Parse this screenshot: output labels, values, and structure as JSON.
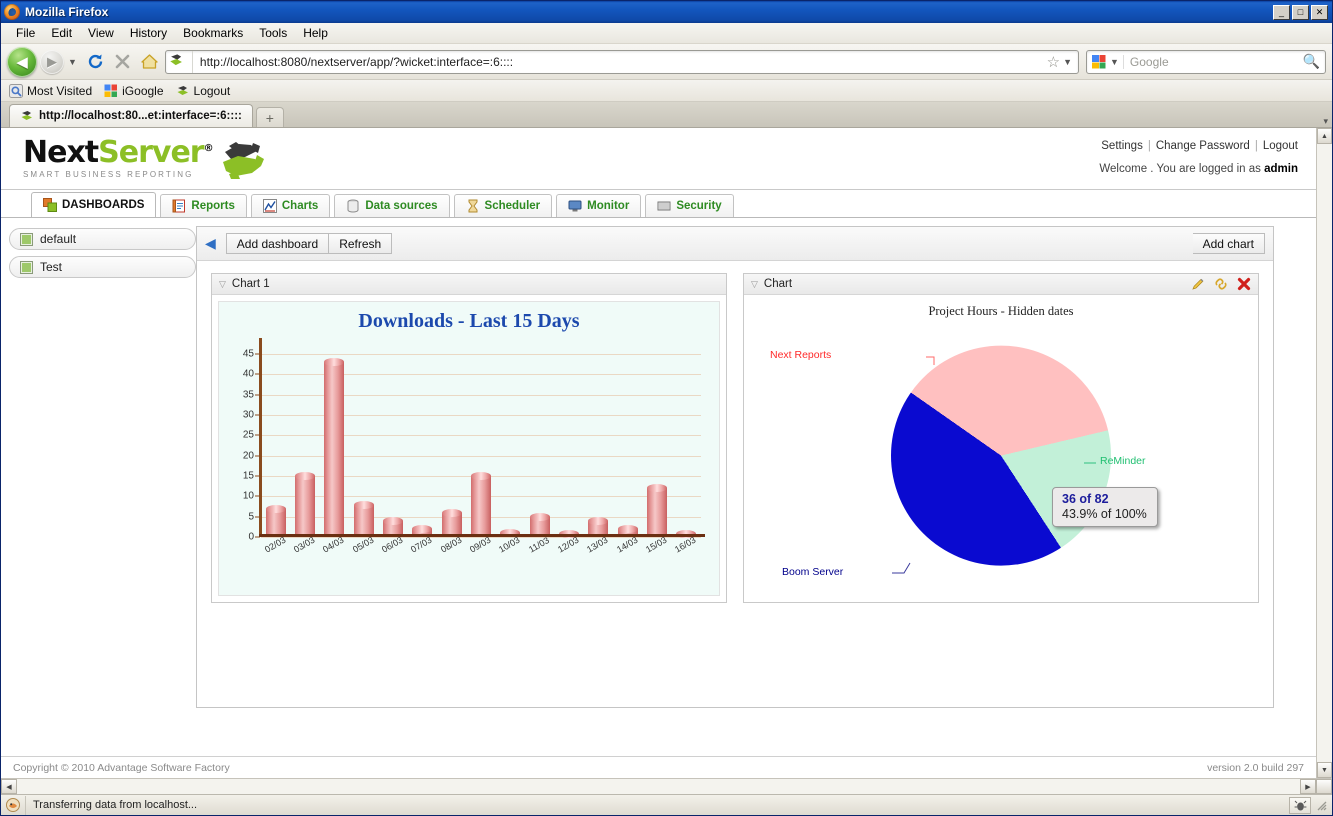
{
  "browser": {
    "window_title": "Mozilla Firefox",
    "window_buttons": {
      "minimize": "_",
      "maximize": "□",
      "close": "✕"
    },
    "menu": [
      "File",
      "Edit",
      "View",
      "History",
      "Bookmarks",
      "Tools",
      "Help"
    ],
    "toolbar": {
      "back": "◀",
      "forward": "▶",
      "reload": "⟳",
      "stop": "✕",
      "home": "⌂",
      "url": "http://localhost:8080/nextserver/app/?wicket:interface=:6::::",
      "bookmark_star": "☆",
      "search_placeholder": "Google",
      "search_engine": "google-icon"
    },
    "bookmarks": [
      "Most Visited",
      "iGoogle",
      "Logout"
    ],
    "tab_title": "http://localhost:80...et:interface=:6::::",
    "new_tab_label": "+",
    "status_text": "Transferring data from localhost..."
  },
  "app": {
    "logo": {
      "part1": "Next",
      "part2": "Server",
      "registered": "®",
      "tagline": "SMART BUSINESS REPORTING"
    },
    "user_links": [
      "Settings",
      "Change Password",
      "Logout"
    ],
    "welcome_prefix": "Welcome . You are logged in as",
    "welcome_user": "admin",
    "tabs": [
      {
        "label": "DASHBOARDS",
        "icon": "dashboards-icon",
        "active": true
      },
      {
        "label": "Reports",
        "icon": "reports-icon",
        "active": false
      },
      {
        "label": "Charts",
        "icon": "charts-icon",
        "active": false
      },
      {
        "label": "Data sources",
        "icon": "datasources-icon",
        "active": false
      },
      {
        "label": "Scheduler",
        "icon": "scheduler-icon",
        "active": false
      },
      {
        "label": "Monitor",
        "icon": "monitor-icon",
        "active": false
      },
      {
        "label": "Security",
        "icon": "security-icon",
        "active": false
      }
    ],
    "sidebar": {
      "items": [
        {
          "label": "default",
          "icon": "dashboard-item-icon"
        },
        {
          "label": "Test",
          "icon": "dashboard-item-icon"
        }
      ]
    },
    "toolbar": {
      "collapse": "◀",
      "add_dashboard": "Add dashboard",
      "refresh": "Refresh",
      "add_chart": "Add chart"
    },
    "widgets": [
      {
        "title": "Chart 1",
        "icons": []
      },
      {
        "title": "Chart",
        "icons": [
          "edit-pencil-icon",
          "link-chain-icon",
          "close-x-icon"
        ]
      }
    ],
    "footer": {
      "copyright": "Copyright © 2010 Advantage Software Factory",
      "version": "version 2.0 build 297"
    }
  },
  "chart_data": [
    {
      "type": "bar",
      "title": "Downloads - Last 15 Days",
      "xlabel": "",
      "ylabel": "",
      "ylim": [
        0,
        47
      ],
      "yticks": [
        0,
        5,
        10,
        15,
        20,
        25,
        30,
        35,
        40,
        45
      ],
      "grid": true,
      "legend": "none",
      "bar_color": "#e08a8a",
      "title_color": "#1c49ad",
      "background": "#f0fbf8",
      "categories": [
        "02/03",
        "03/03",
        "04/03",
        "05/03",
        "06/03",
        "07/03",
        "08/03",
        "09/03",
        "10/03",
        "11/03",
        "12/03",
        "13/03",
        "14/03",
        "15/03",
        "16/03"
      ],
      "values": [
        7,
        15,
        43,
        8,
        4,
        2,
        6,
        15,
        1,
        5,
        0.8,
        4,
        2,
        12,
        0.8
      ]
    },
    {
      "type": "pie",
      "title": "Project Hours - Hidden dates",
      "legend": "labels-outside",
      "total": 82,
      "slices": [
        {
          "label": "Next Reports",
          "value": 30,
          "percent": 36.6,
          "color": "#ffc0c0",
          "label_color": "#ff2a2a"
        },
        {
          "label": "ReMinder",
          "value": 16,
          "percent": 19.5,
          "color": "#c2f0d8",
          "label_color": "#1fbf70"
        },
        {
          "label": "Boom Server",
          "value": 36,
          "percent": 43.9,
          "color": "#0a0ad0",
          "label_color": "#00008b"
        }
      ],
      "tooltip": {
        "line1": "36 of 82",
        "line2": "43.9% of 100%"
      }
    }
  ]
}
